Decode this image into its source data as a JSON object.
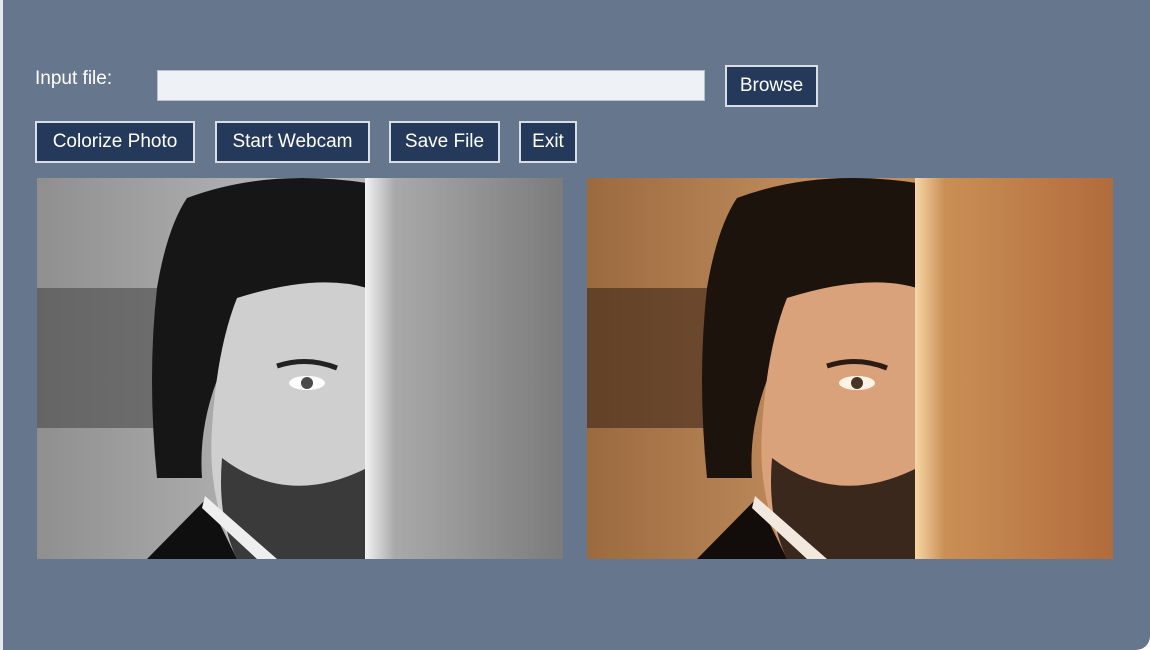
{
  "input_row": {
    "label": "Input file:",
    "value": "",
    "browse_label": "Browse"
  },
  "toolbar": {
    "colorize_label": "Colorize Photo",
    "webcam_label": "Start Webcam",
    "save_label": "Save File",
    "exit_label": "Exit"
  },
  "images": {
    "input": "grayscale-portrait",
    "output": "colorized-portrait"
  }
}
